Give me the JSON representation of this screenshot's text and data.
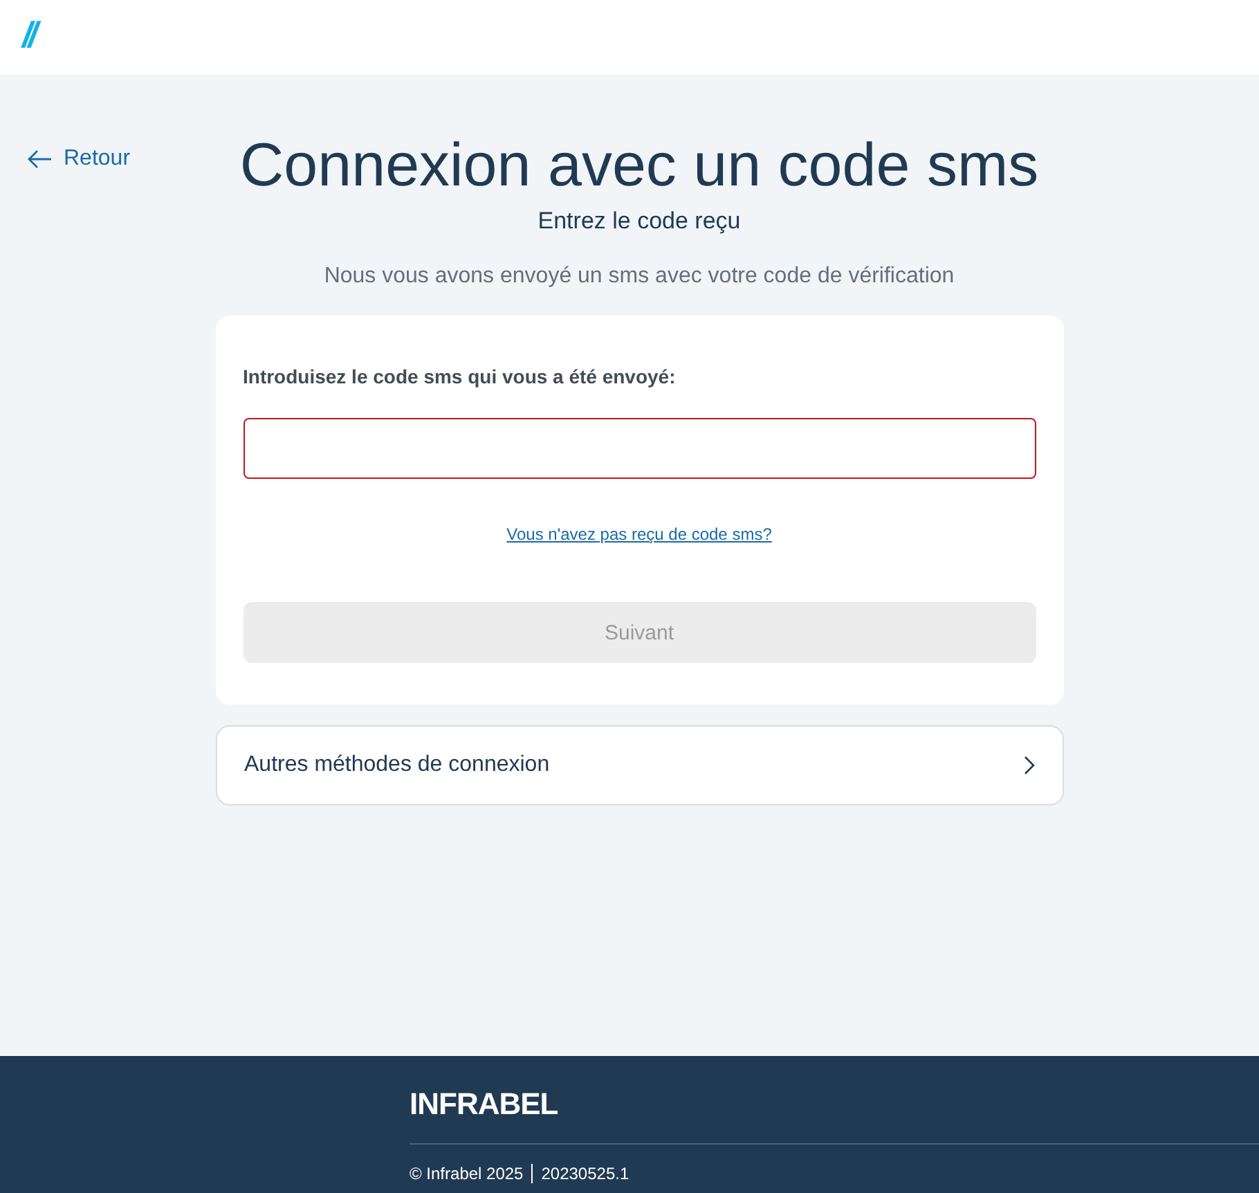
{
  "header": {
    "logo": "//"
  },
  "back_link": {
    "label": "Retour"
  },
  "title": "Connexion avec un code sms",
  "subtitle": "Entrez le code reçu",
  "description": "Nous vous avons envoyé un sms avec votre code de vérification",
  "form": {
    "label": "Introduisez le code sms qui vous a été envoyé:",
    "field": {
      "error": true
    },
    "resend_link": "Vous n'avez pas reçu de code sms?",
    "submit": {
      "label": "Suivant",
      "disabled": true
    }
  },
  "other_methods": {
    "label": "Autres méthodes de connexion"
  },
  "footer": {
    "logo": "INFRABEL",
    "copyright": "© Infrabel 2025",
    "version": "20230525.1"
  }
}
